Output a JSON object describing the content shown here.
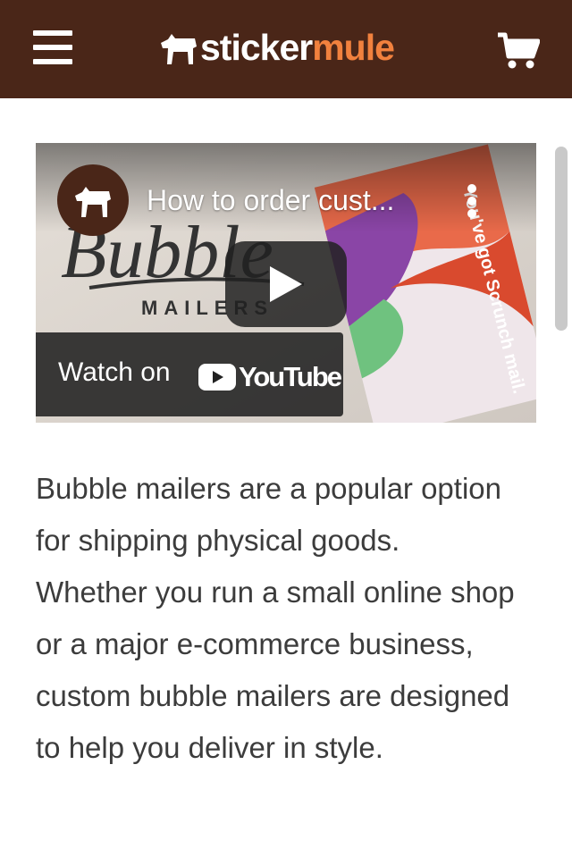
{
  "header": {
    "logo_part1": "sticker",
    "logo_part2": "mule",
    "logo_accent_color": "#f1813e",
    "background_color": "#4a2618",
    "menu_icon": "hamburger-menu-icon",
    "cart_icon": "shopping-cart-icon"
  },
  "video": {
    "title": "How to order cust...",
    "watch_on": "Watch on",
    "youtube_wordmark": "YouTube",
    "thumbnail_script_text": "Bubble",
    "thumbnail_caption": "MAILERS",
    "thumbnail_package_text": "You've got Scrunch mail.",
    "play_icon": "play-icon",
    "more_icon": "more-vertical-icon"
  },
  "content": {
    "paragraph": "Bubble mailers are a popular option for shipping physical goods. Whether you run a small online shop or a major e-commerce business, custom bubble mailers are designed to help you deliver in style."
  }
}
